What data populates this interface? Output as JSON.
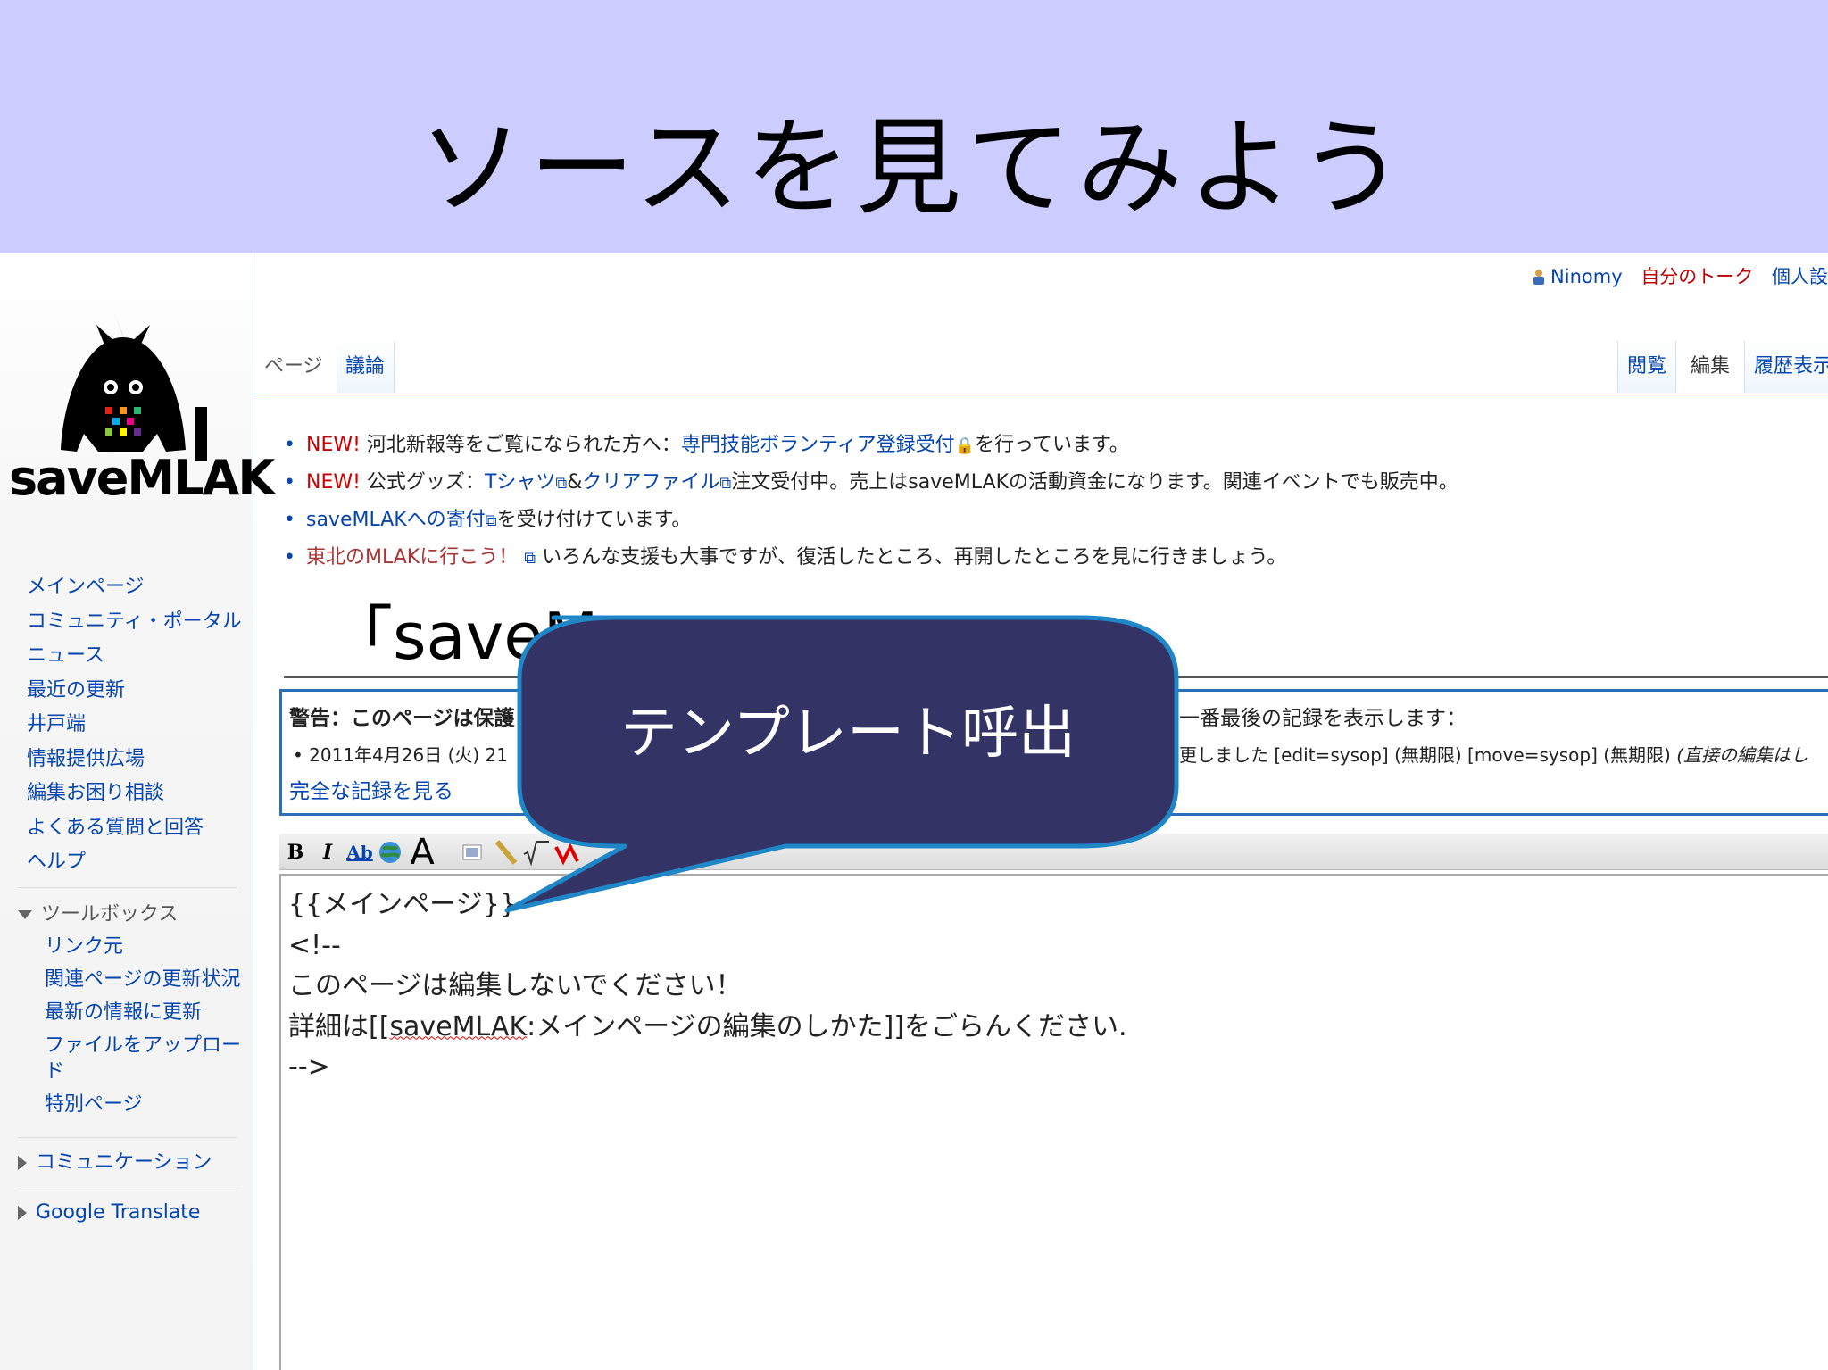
{
  "slide": {
    "title": "ソースを見てみよう"
  },
  "personal": {
    "user": "Ninomy",
    "talk": "自分のトーク",
    "prefs": "個人設"
  },
  "logo": {
    "text": "saveMLAK"
  },
  "nav": {
    "items": [
      "メインページ",
      "コミュニティ・ポータル",
      "ニュース",
      "最近の更新",
      "井戸端",
      "情報提供広場",
      "編集お困り相談",
      "よくある質問と回答",
      "ヘルプ"
    ]
  },
  "toolbox": {
    "heading": "ツールボックス",
    "items": [
      "リンク元",
      "関連ページの更新状況",
      "最新の情報に更新",
      "ファイルをアップロード",
      "特別ページ"
    ]
  },
  "portlets": {
    "communication": "コミュニケーション",
    "translate": "Google Translate"
  },
  "tabs": {
    "page": "ページ",
    "talk": "議論",
    "read": "閲覧",
    "edit": "編集",
    "history": "履歴表示"
  },
  "notices": [
    {
      "badge": "NEW!",
      "pre": "河北新報等をご覧になられた方へ：",
      "link": "専門技能ボランティア登録受付",
      "post": "を行っています。"
    },
    {
      "badge": "NEW!",
      "pre": "公式グッズ：",
      "link": "Tシャツ",
      "mid": "&",
      "link2": "クリアファイル",
      "post": "注文受付中。売上はsaveMLAKの活動資金になります。関連イベントでも販売中。"
    },
    {
      "link": "saveMLAKへの寄付",
      "post": "を受け付けています。"
    },
    {
      "link": "東北のMLAKに行こう！",
      "post": "いろんな支援も大事ですが、復活したところ、再開したところを見に行きましょう。"
    }
  ],
  "heading": {
    "text": "「saveM"
  },
  "warning": {
    "title": "警告：このページは保護",
    "right": "一番最後の記録を表示します：",
    "log_left": "• 2011年4月26日 (火) 21",
    "log_right_a": "更しました [edit=sysop] (無期限) [move=sysop] (無期限) ",
    "log_right_b": "(直接の編集はし",
    "full_log": "完全な記録を見る"
  },
  "toolbar": {
    "bold": "B",
    "italic": "I",
    "link": "Ab",
    "headline": "A"
  },
  "editor": {
    "lines": [
      "{{メインページ}}",
      "<!--",
      "このページは編集しないでください！"
    ],
    "line4_pre": "詳細は[[",
    "line4_sq": "saveMLAK",
    "line4_post": ":メインページの編集のしかた]]をごらんください.",
    "line5": "-->"
  },
  "callout": {
    "text": "テンプレート呼出",
    "fill": "#333366",
    "stroke": "#1f86c8"
  }
}
